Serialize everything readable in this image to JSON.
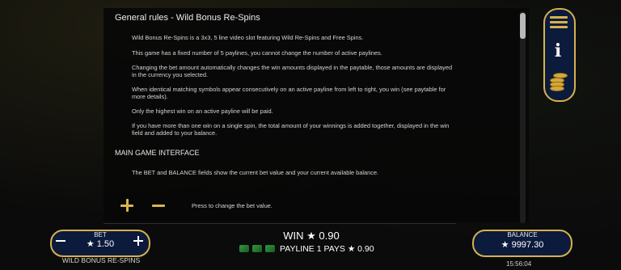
{
  "help": {
    "title": "General rules - Wild Bonus Re-Spins",
    "paragraphs": [
      "Wild Bonus Re-Spins is a 3x3, 5 line video slot featuring Wild Re-Spins and Free Spins.",
      "This game has a fixed number of 5 paylines, you cannot change the number of active paylines.",
      "Changing the bet amount automatically changes the win amounts displayed in the paytable, those amounts are displayed in the currency you selected.",
      "When identical matching symbols appear consecutively on an active payline from left to right, you win (see paytable for more details).",
      "Only the highest win on an active payline will be paid.",
      "If you have more than one win on a single spin, the total amount of your winnings is added together, displayed in the win field and added to your balance."
    ],
    "section_title": "MAIN GAME INTERFACE",
    "interface_text": "The BET and BALANCE fields show the current bet value and your current available balance.",
    "bet_control_text": "Press to change the bet value."
  },
  "side_menu": {
    "menu_icon": "hamburger-menu-icon",
    "info_icon": "info-icon",
    "info_glyph": "i",
    "coins_icon": "coins-stack-icon"
  },
  "bet": {
    "label": "BET",
    "value": "★ 1.50"
  },
  "game_name": "WILD BONUS RE-SPINS",
  "win": {
    "text": "WIN ★ 0.90",
    "payline_text": "PAYLINE 1 PAYS ★ 0.90",
    "symbol_icons": [
      "clover-symbol-icon",
      "clover-symbol-icon",
      "clover-symbol-icon"
    ]
  },
  "balance": {
    "label": "BALANCE",
    "value": "★ 9997.30"
  },
  "clock": "15:56:04",
  "colors": {
    "accent_gold": "#d6b24c",
    "panel_navy": "#0c1a3c",
    "background": "#0b0b0b"
  }
}
